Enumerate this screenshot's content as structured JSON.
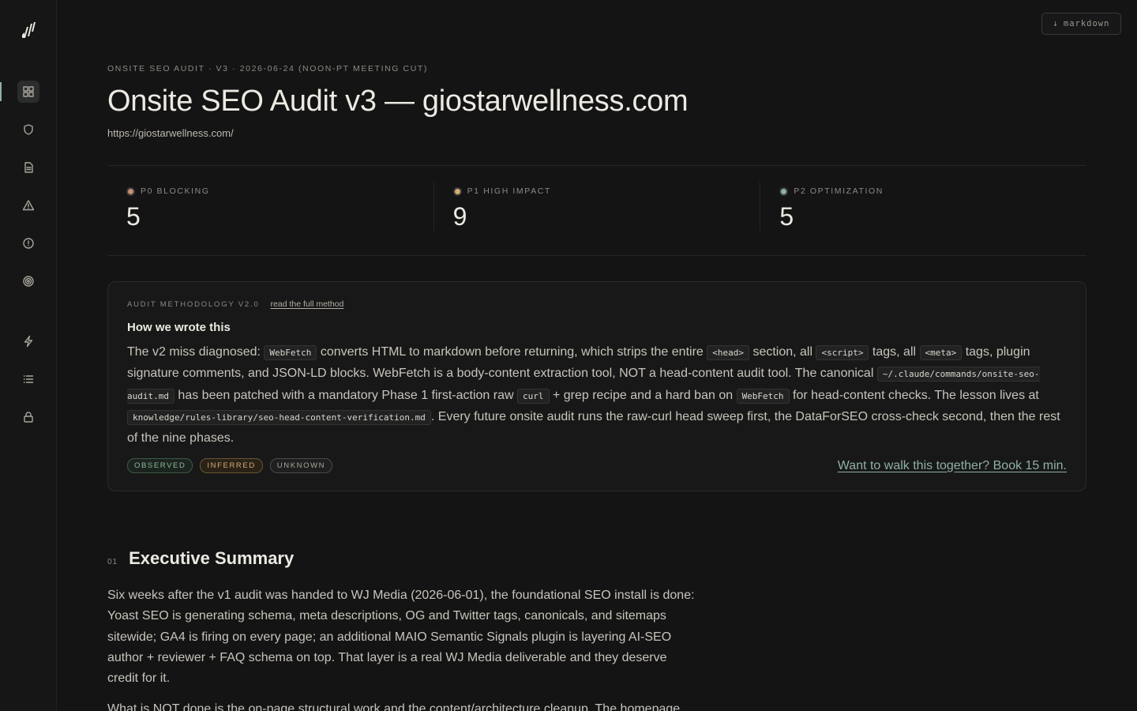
{
  "sidebar": {
    "items": [
      {
        "icon": "grid-icon",
        "active": true
      },
      {
        "icon": "shield-icon"
      },
      {
        "icon": "document-icon"
      },
      {
        "icon": "warning-icon"
      },
      {
        "icon": "info-icon"
      },
      {
        "icon": "target-icon"
      },
      {
        "icon": "bolt-icon"
      },
      {
        "icon": "list-icon"
      },
      {
        "icon": "lock-icon"
      }
    ]
  },
  "toolbar": {
    "markdown_label": "markdown",
    "markdown_icon": "↓"
  },
  "header": {
    "eyebrow": "ONSITE SEO AUDIT · V3 · 2026-06-24 (NOON-PT MEETING CUT)",
    "title": "Onsite SEO Audit v3 — giostarwellness.com",
    "url": "https://giostarwellness.com/"
  },
  "stats": [
    {
      "label": "P0 BLOCKING",
      "value": "5",
      "color": "#c98d74"
    },
    {
      "label": "P1 HIGH IMPACT",
      "value": "9",
      "color": "#d2ad72"
    },
    {
      "label": "P2 OPTIMIZATION",
      "value": "5",
      "color": "#8fb0a6"
    }
  ],
  "methodology": {
    "eyebrow": "AUDIT METHODOLOGY V2.0",
    "link": "read the full method",
    "title": "How we wrote this",
    "body": {
      "t1": "The v2 miss diagnosed: ",
      "c1": "WebFetch",
      "t2": " converts HTML to markdown before returning, which strips the entire ",
      "c2": "<head>",
      "t3": " section, all ",
      "c3": "<script>",
      "t4": " tags, all ",
      "c4": "<meta>",
      "t5": " tags, plugin signature comments, and JSON-LD blocks. WebFetch is a body-content extraction tool, NOT a head-content audit tool. The canonical ",
      "c5": "~/.claude/commands/onsite-seo-audit.md",
      "t6": " has been patched with a mandatory Phase 1 first-action raw ",
      "c6": "curl",
      "t7": " + grep recipe and a hard ban on ",
      "c7": "WebFetch",
      "t8": " for head-content checks. The lesson lives at ",
      "c8": "knowledge/rules-library/seo-head-content-verification.md",
      "t9": ". Every future onsite audit runs the raw-curl head sweep first, the DataForSEO cross-check second, then the rest of the nine phases."
    },
    "tags": [
      "OBSERVED",
      "INFERRED",
      "UNKNOWN"
    ],
    "cta": "Want to walk this together? Book 15 min."
  },
  "section": {
    "number": "01",
    "title": "Executive Summary",
    "p1": "Six weeks after the v1 audit was handed to WJ Media (2026-06-01), the foundational SEO install is done: Yoast SEO is generating schema, meta descriptions, OG and Twitter tags, canonicals, and sitemaps sitewide; GA4 is firing on every page; an additional MAIO Semantic Signals plugin is layering AI-SEO author + reviewer + FAQ schema on top. That layer is a real WJ Media deliverable and they deserve credit for it.",
    "p2": "What is NOT done is the on-page structural work and the content/architecture cleanup. The homepage"
  }
}
